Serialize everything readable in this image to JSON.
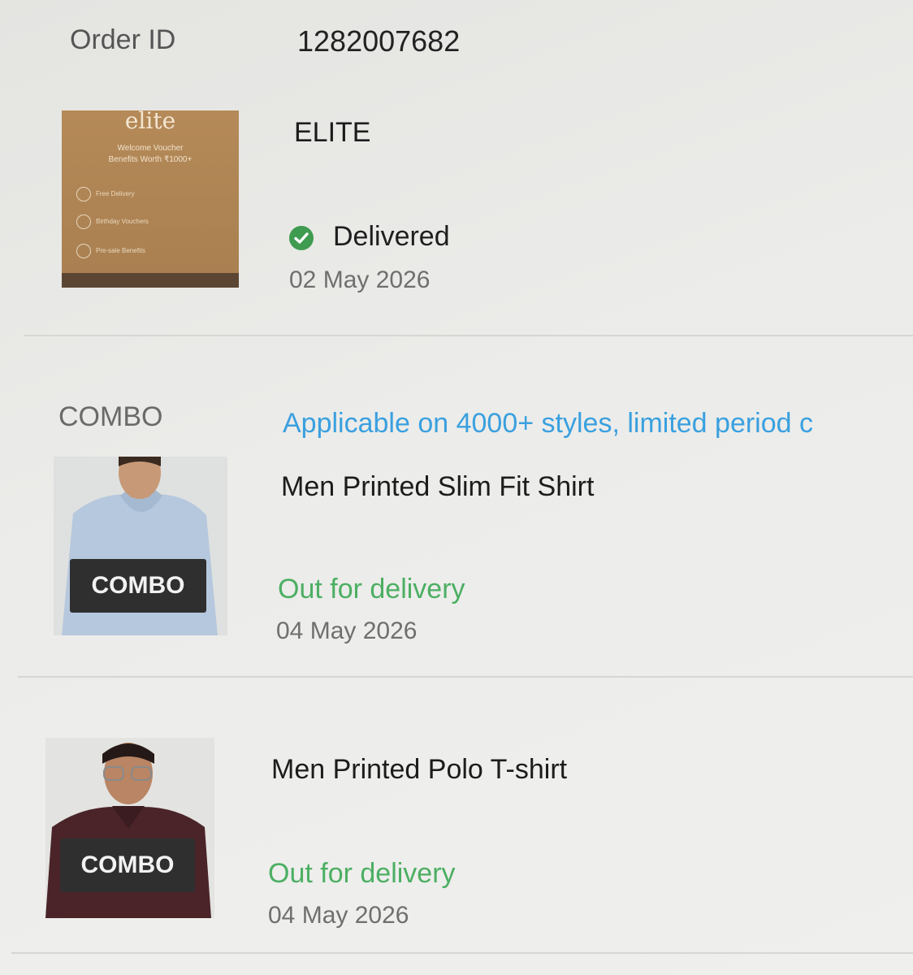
{
  "order": {
    "id_label": "Order ID",
    "id_value": "1282007682"
  },
  "elite_item": {
    "title": "ELITE",
    "status": "Delivered",
    "date": "02 May 2026",
    "thumbnail": {
      "brand": "elite",
      "line1": "Welcome Voucher",
      "line2": "Benefits Worth ₹1000+",
      "benefits": [
        "Free Delivery",
        "Birthday Vouchers",
        "Pre-sale Benefits"
      ]
    }
  },
  "combo_header": {
    "label": "COMBO",
    "offer": "Applicable on 4000+ styles, limited period c"
  },
  "items": [
    {
      "title": "Men Printed Slim Fit Shirt",
      "status": "Out for delivery",
      "date": "04 May 2026",
      "badge": "COMBO"
    },
    {
      "title": "Men Printed Polo T-shirt",
      "status": "Out for delivery",
      "date": "04 May 2026",
      "badge": "COMBO"
    }
  ],
  "colors": {
    "delivered_green": "#3f9b4f",
    "out_for_delivery_green": "#4caf63",
    "offer_blue": "#3aa0df"
  }
}
